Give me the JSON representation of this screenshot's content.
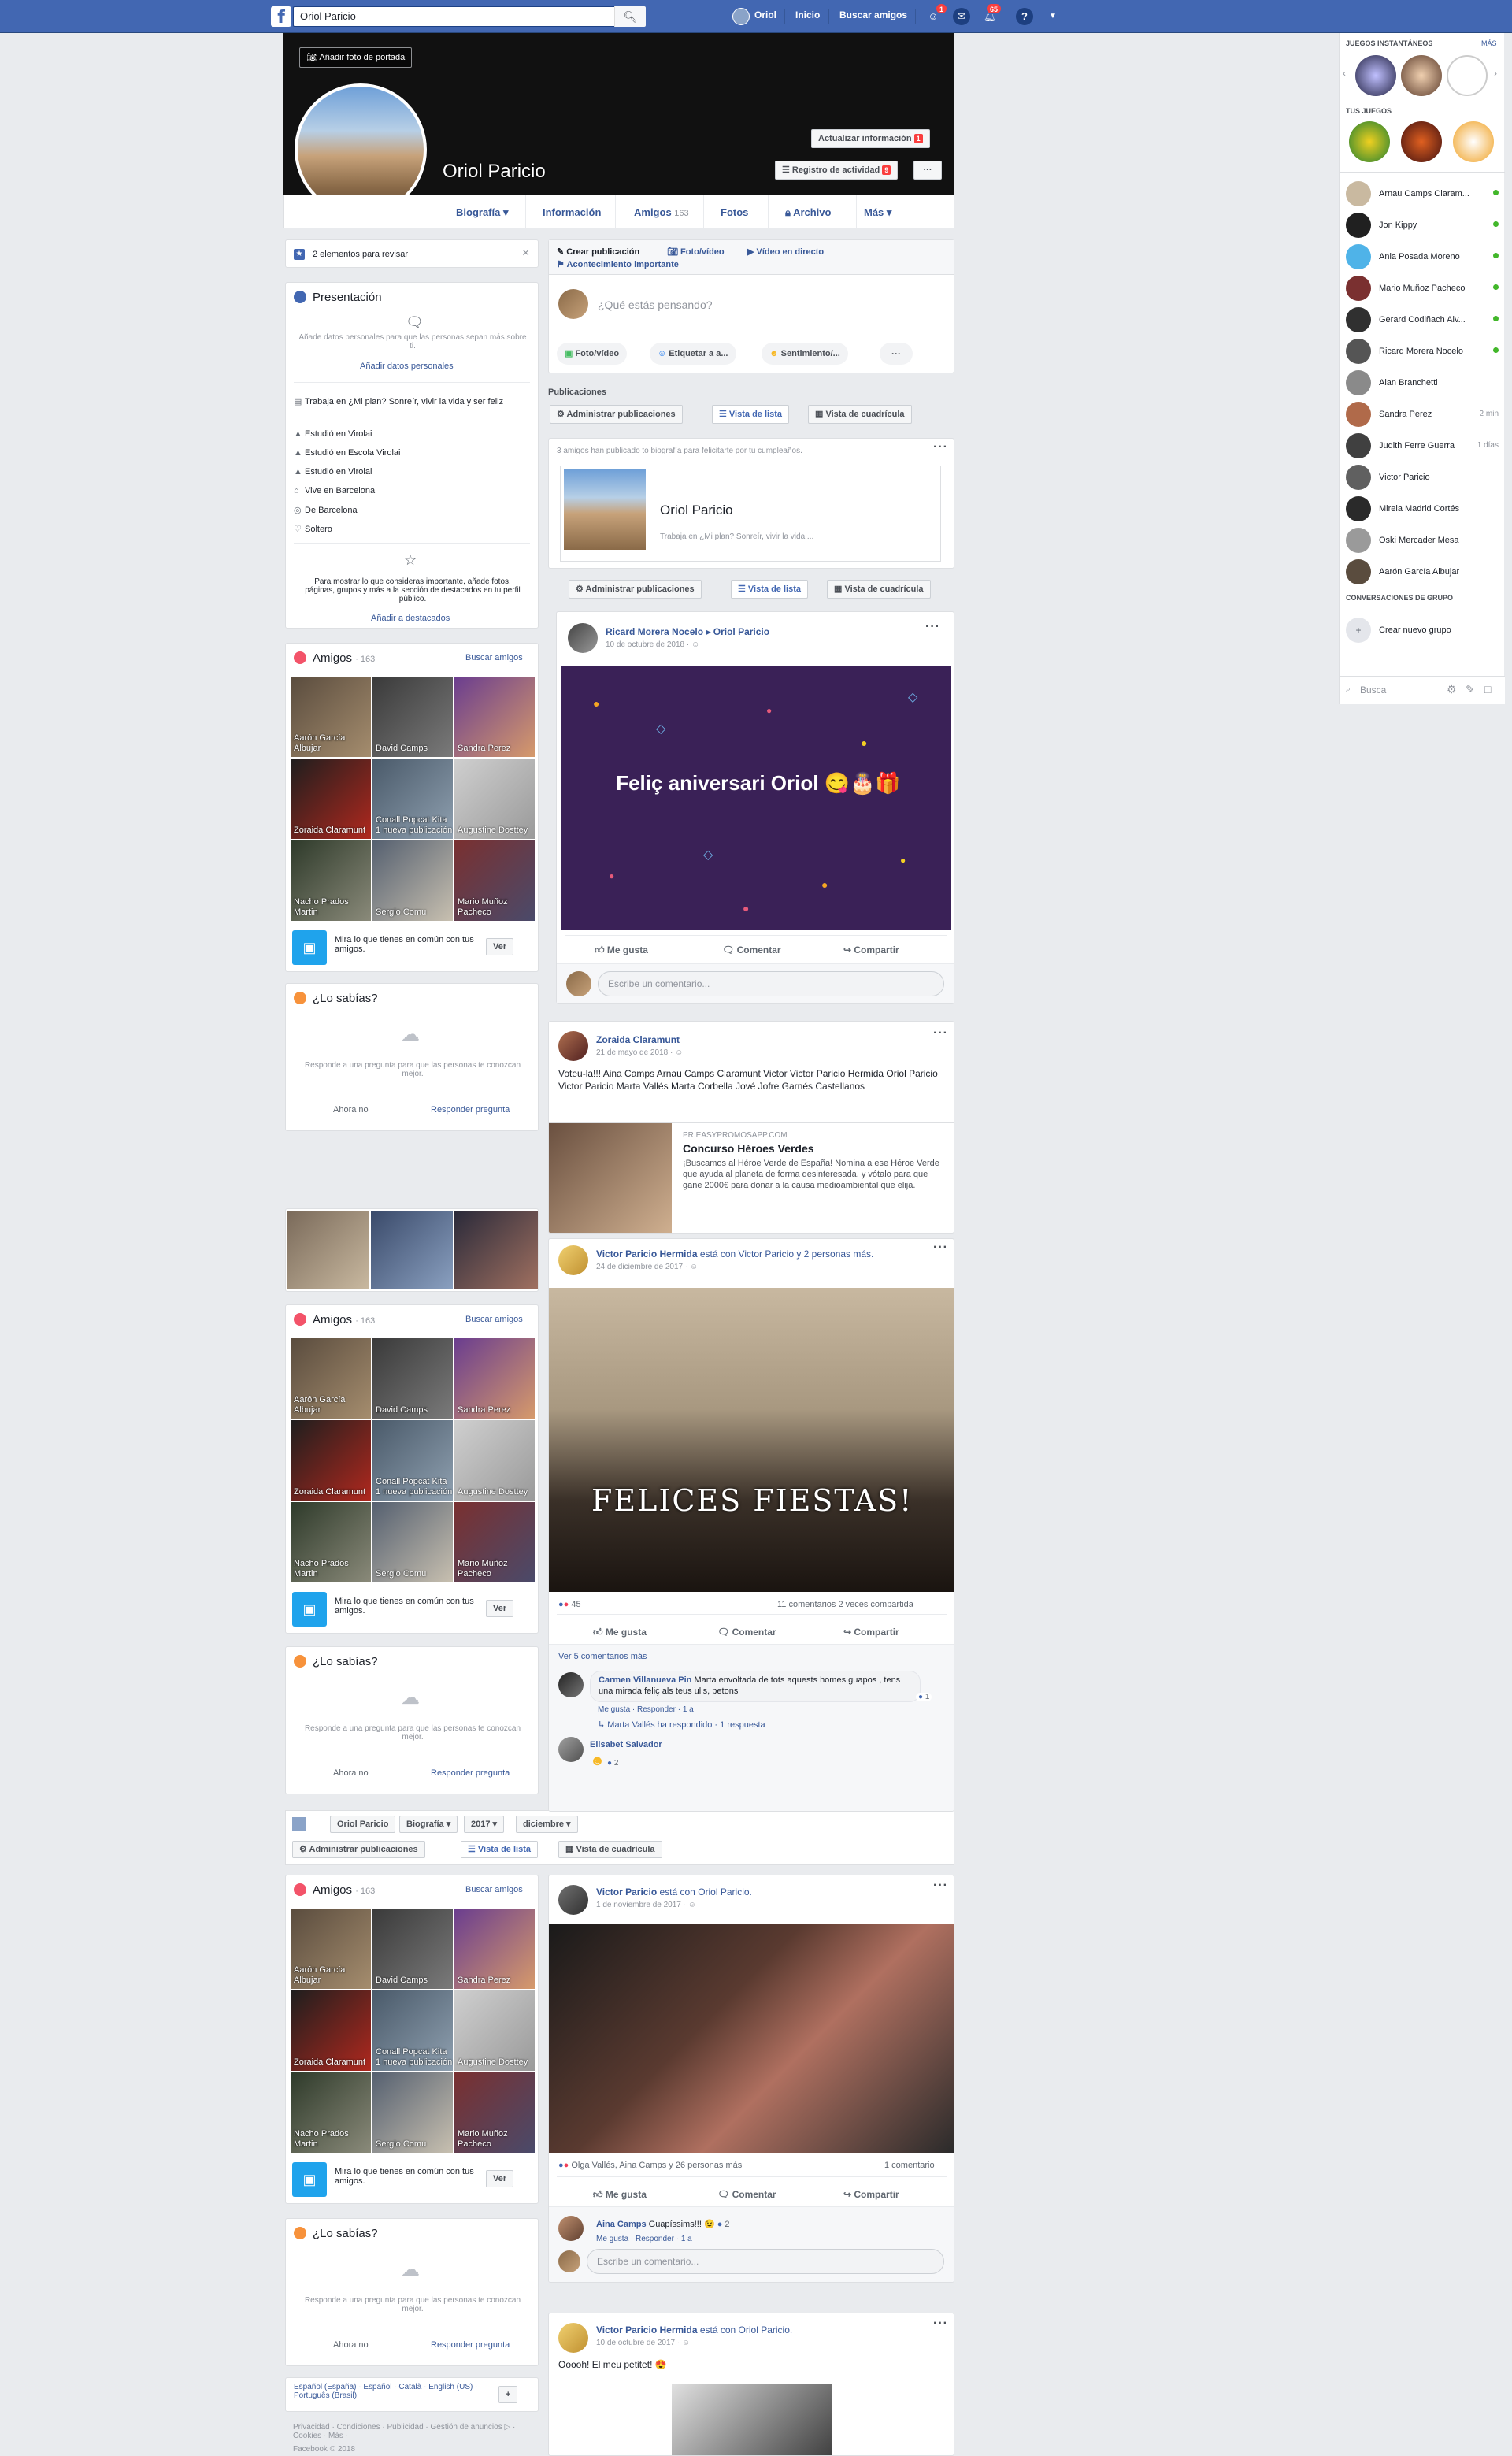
{
  "topbar": {
    "logo": "f",
    "search_value": "Oriol Paricio",
    "user_name": "Oriol",
    "home": "Inicio",
    "find_friends": "Buscar amigos",
    "friend_badge": "1",
    "notif_badge": "65"
  },
  "cover": {
    "add_cover": "Añadir foto de portada",
    "name": "Oriol Paricio",
    "update_info": "Actualizar información",
    "update_badge": "1",
    "activity_log": "Registro de actividad",
    "activity_badge": "9",
    "more_dots": "···"
  },
  "tabs": {
    "timeline": "Biografía ▾",
    "info": "Información",
    "friends": "Amigos",
    "friends_count": "163",
    "photos": "Fotos",
    "archive": "Archivo",
    "more": "Más ▾"
  },
  "review": {
    "text": "2 elementos para revisar",
    "close": "×"
  },
  "intro": {
    "title": "Presentación",
    "desc": "Añade datos personales para que las personas sepan más sobre ti.",
    "add_link": "Añadir datos personales",
    "rows": [
      "Trabaja en ¿Mi plan? Sonreír, vivir la vida y ser feliz",
      "Estudió en Virolai",
      "Estudió en Escola Virolai",
      "Estudió en Virolai",
      "Vive en Barcelona",
      "De Barcelona",
      "Soltero"
    ],
    "featured_desc": "Para mostrar lo que consideras importante, añade fotos, páginas, grupos y más a la sección de destacados en tu perfil público.",
    "featured_link": "Añadir a destacados"
  },
  "friends_box": {
    "title": "Amigos",
    "count": "· 163",
    "find": "Buscar amigos",
    "names": [
      "Aarón García Albujar",
      "David Camps",
      "Sandra Perez",
      "Zoraida Claramunt",
      "Conall Popcat Kita 1 nueva publicación",
      "Augustine Dosttey",
      "Nacho Prados Martin",
      "Sergio Comu",
      "Mario Muñoz Pacheco"
    ],
    "common": "Mira lo que tienes en común con tus amigos.",
    "see": "Ver"
  },
  "didyouknow": {
    "title": "¿Lo sabías?",
    "desc": "Responde a una pregunta para que las personas te conozcan mejor.",
    "not_now": "Ahora no",
    "answer": "Responder pregunta"
  },
  "composer": {
    "create_post": "Crear publicación",
    "photo_video": "Foto/vídeo",
    "live": "Vídeo en directo",
    "life_event": "Acontecimiento importante",
    "placeholder": "¿Qué estás pensando?",
    "btn_photo": "Foto/vídeo",
    "btn_tag": "Etiquetar a a...",
    "btn_feeling": "Sentimiento/...",
    "btn_more": "···"
  },
  "posts_header": {
    "label": "Publicaciones",
    "manage": "Administrar publicaciones",
    "list_view": "Vista de lista",
    "grid_view": "Vista de cuadrícula"
  },
  "bday": {
    "text": "3 amigos han publicado to biografía para felicitarte por tu cumpleaños.",
    "name": "Oriol Paricio",
    "works": "Trabaja en ¿Mi plan? Sonreír, vivir la vida ..."
  },
  "post1": {
    "author": "Ricard Morera Nocelo ▸ Oriol Paricio",
    "date": "10 de octubre de 2018 · ",
    "image_text": "Feliç aniversari Oriol 😋🎂🎁",
    "like": "Me gusta",
    "comment": "Comentar",
    "share": "Compartir",
    "write_comment": "Escribe un comentario..."
  },
  "post2": {
    "author": "Zoraida Claramunt",
    "date": "21 de mayo de 2018 · ",
    "text": "Voteu-la!!! Aina Camps Arnau Camps Claramunt Victor Victor Paricio Hermida Oriol Paricio Victor Paricio Marta Vallés Marta Corbella Jové Jofre Garnés Castellanos",
    "link_domain": "PR.EASYPROMOSAPP.COM",
    "link_title": "Concurso Héroes Verdes",
    "link_desc": "¡Buscamos al Héroe Verde de España! Nomina a ese Héroe Verde que ayuda al planeta de forma desinteresada, y vótalo para que gane 2000€ para donar a la causa medioambiental que elija."
  },
  "post3": {
    "author": "Victor Paricio Hermida",
    "with": " está con Victor Paricio y 2 personas más.",
    "date": "24 de diciembre de 2017 · ",
    "image_text": "FELICES FIESTAS!",
    "reactions": "45",
    "comments_count": "11 comentarios   2 veces compartida",
    "more_comments": "Ver 5 comentarios más",
    "c1_name": "Carmen Villanueva Pin",
    "c1_text": "Marta envoltada de tots aquests homes guapos , tens una mirada feliç als teus ulls, petons",
    "c1_meta": "Me gusta · Responder · 1 a",
    "c1_likes": "1",
    "reply": "Marta Vallés ha respondido · 1 respuesta",
    "c2_name": "Elisabet Salvador",
    "c2_likes": "2"
  },
  "sticky": {
    "name": "Oriol Paricio",
    "bio": "Biografía ▾",
    "year": "2017 ▾",
    "month": "diciembre ▾"
  },
  "post4": {
    "author": "Victor Paricio",
    "with": " está con Oriol Paricio.",
    "date": "1 de noviembre de 2017 · ",
    "reactions": "Olga Vallés, Aina Camps y 26 personas más",
    "comments_count": "1 comentario",
    "c1_name": "Aina Camps",
    "c1_text": "Guapíssims!!! 😉",
    "c1_likes": "2",
    "c1_meta": "Me gusta · Responder · 1 a"
  },
  "post5": {
    "author": "Victor Paricio Hermida",
    "with": " está con Oriol Paricio.",
    "date": "10 de octubre de 2017 · ",
    "text": "Ooooh! El meu petitet! 😍"
  },
  "footer": {
    "langs": "Español (España) · Español · Català · English (US) · Português (Brasil)",
    "links": "Privacidad · Condiciones · Publicidad · Gestión de anuncios ▷ · Cookies · Más ·",
    "copy": "Facebook © 2018",
    "plus": "+"
  },
  "chat": {
    "instant_games": "JUEGOS INSTANTÁNEOS",
    "more": "MÁS",
    "your_games": "TUS JUEGOS",
    "contacts": [
      {
        "name": "Arnau Camps Claram...",
        "status": "online"
      },
      {
        "name": "Jon Kippy",
        "status": "online"
      },
      {
        "name": "Ania Posada Moreno",
        "status": "online"
      },
      {
        "name": "Mario Muñoz Pacheco",
        "status": "online"
      },
      {
        "name": "Gerard Codiñach Alv...",
        "status": "online"
      },
      {
        "name": "Ricard Morera Nocelo",
        "status": "online"
      },
      {
        "name": "Alan Branchetti",
        "status": ""
      },
      {
        "name": "Sandra Perez",
        "status": "2 min"
      },
      {
        "name": "Judith Ferre Guerra",
        "status": "1 días"
      },
      {
        "name": "Victor Paricio",
        "status": ""
      },
      {
        "name": "Mireia Madrid Cortés",
        "status": ""
      },
      {
        "name": "Oski Mercader Mesa",
        "status": ""
      },
      {
        "name": "Aarón García Albujar",
        "status": ""
      }
    ],
    "group_convos": "CONVERSACIONES DE GRUPO",
    "new_group": "Crear nuevo grupo",
    "search": "Busca"
  }
}
